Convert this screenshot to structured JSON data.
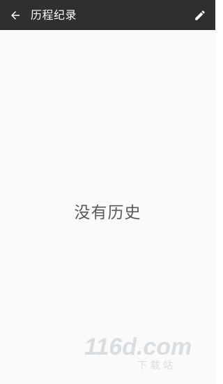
{
  "app_bar": {
    "title": "历程纪录",
    "back_icon": "arrow-left-icon",
    "edit_icon": "pencil-icon",
    "background": "#2f2f2f"
  },
  "content": {
    "empty_text": "没有历史"
  },
  "watermark": {
    "brand": "116d.com",
    "tagline": "下载站"
  }
}
